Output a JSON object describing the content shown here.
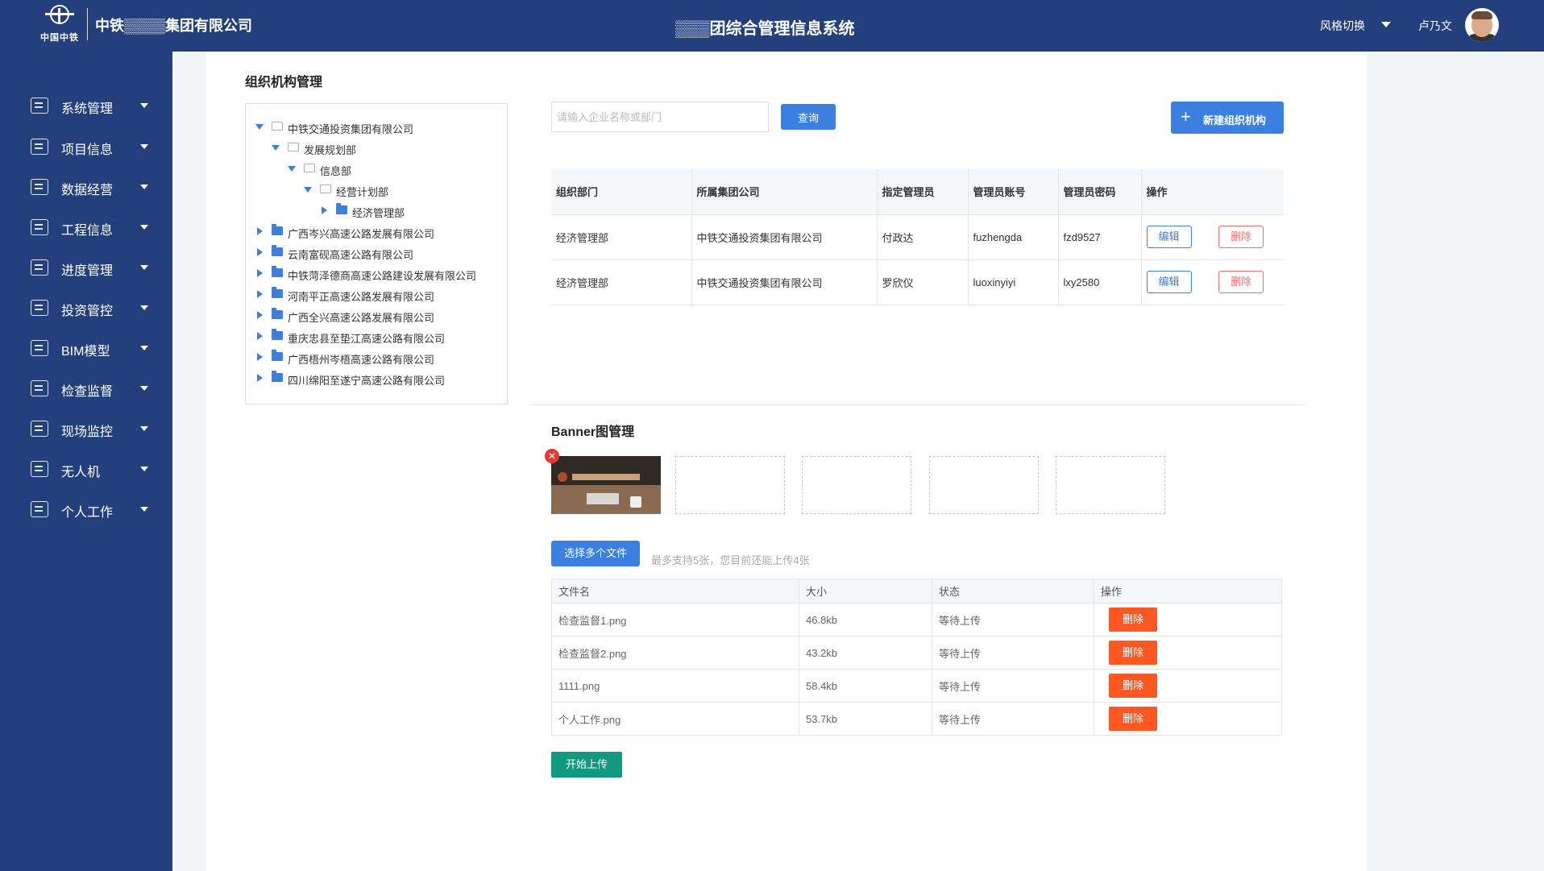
{
  "header": {
    "logo_text": "中国中铁",
    "company": "中铁▒▒▒▒集团有限公司",
    "title": "▒▒▒团综合管理信息系统",
    "style_switch": "风格切换",
    "user_name": "卢乃文"
  },
  "sidebar": {
    "items": [
      {
        "label": "系统管理",
        "icon": "monitor-icon"
      },
      {
        "label": "项目信息",
        "icon": "document-icon"
      },
      {
        "label": "数据经营",
        "icon": "coins-icon"
      },
      {
        "label": "工程信息",
        "icon": "file-icon"
      },
      {
        "label": "进度管理",
        "icon": "progress-chart-icon"
      },
      {
        "label": "投资管控",
        "icon": "line-chart-icon"
      },
      {
        "label": "BIM模型",
        "icon": "eye-icon"
      },
      {
        "label": "检查监督",
        "icon": "clipboard-icon"
      },
      {
        "label": "现场监控",
        "icon": "camera-icon"
      },
      {
        "label": "无人机",
        "icon": "drone-icon"
      },
      {
        "label": "个人工作",
        "icon": "id-card-icon"
      }
    ]
  },
  "org": {
    "title": "组织机构管理",
    "tree": [
      "中铁交通投资集团有限公司",
      "发展规划部",
      "信息部",
      "经营计划部",
      "经济管理部",
      "广西岑兴高速公路发展有限公司",
      "云南富砚高速公路有限公司",
      "中铁菏泽德商高速公路建设发展有限公司",
      "河南平正高速公路发展有限公司",
      "广西全兴高速公路发展有限公司",
      "重庆忠县至垫江高速公路有限公司",
      "广西梧州岑梧高速公路有限公司",
      "四川绵阳至遂宁高速公路有限公司"
    ],
    "search_placeholder": "请输入企业名称或部门",
    "query_label": "查询",
    "new_label": "新建组织机构",
    "table": {
      "headers": [
        "组织部门",
        "所属集团公司",
        "指定管理员",
        "管理员账号",
        "管理员密码",
        "操作"
      ],
      "rows": [
        [
          "经济管理部",
          "中铁交通投资集团有限公司",
          "付政达",
          "fuzhengda",
          "fzd9527"
        ],
        [
          "经济管理部",
          "中铁交通投资集团有限公司",
          "罗欣仪",
          "luoxinyiyi",
          "lxy2580"
        ]
      ],
      "edit_label": "编辑",
      "delete_label": "删除"
    }
  },
  "banner": {
    "title": "Banner图管理",
    "choose_label": "选择多个文件",
    "hint": "最多支持5张，您目前还能上传4张",
    "table": {
      "headers": [
        "文件名",
        "大小",
        "状态",
        "操作"
      ],
      "rows": [
        [
          "检查监督1.png",
          "46.8kb",
          "等待上传"
        ],
        [
          "检查监督2.png",
          "43.2kb",
          "等待上传"
        ],
        [
          "1111.png",
          "58.4kb",
          "等待上传"
        ],
        [
          "个人工作.png",
          "53.7kb",
          "等待上传"
        ]
      ],
      "delete_label": "删除"
    },
    "start_label": "开始上传"
  },
  "colors": {
    "primary": "#24407c",
    "accent": "#3b7fe0",
    "danger": "#ff5722",
    "success": "#129a80"
  }
}
